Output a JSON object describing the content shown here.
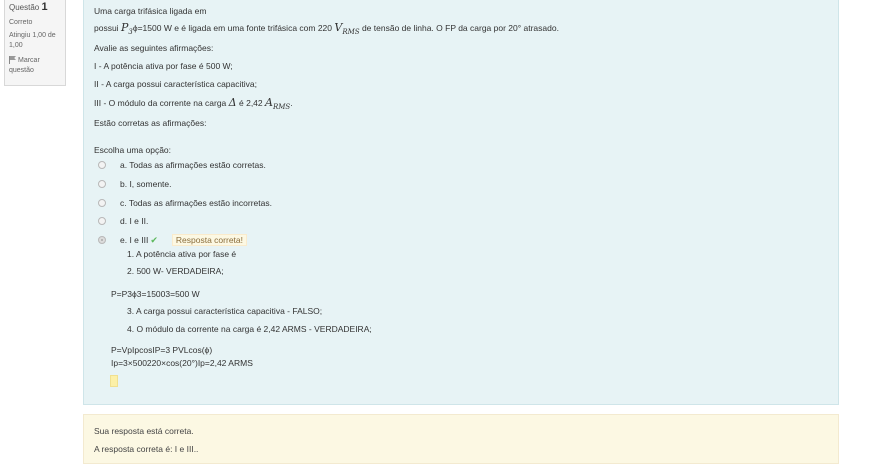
{
  "info": {
    "question_label": "Questão",
    "question_number": "1",
    "state": "Correto",
    "grade": "Atingiu 1,00 de 1,00",
    "flag_label": "Marcar questão"
  },
  "question": {
    "line1": "Uma carga trifásica ligada em",
    "line2_pre": "possui",
    "p_symbol": "P",
    "p_sub": "3",
    "line2_mid": "ϕ=1500 W e é ligada em uma fonte trifásica com 220",
    "v_symbol": "V",
    "v_sub": "RMS",
    "line2_post": "de tensão de linha. O FP da carga por 20° atrasado.",
    "line3": "Avalie as seguintes afirmações:",
    "line4": "I - A potência ativa por fase é 500 W;",
    "line5": "II - A carga possui característica capacitiva;",
    "line6_pre": "III - O módulo da corrente na carga",
    "delta_symbol": "Δ",
    "line6_mid": "é 2,42",
    "a_symbol": "A",
    "a_sub": "RMS",
    "line6_post": ".",
    "line7": "Estão corretas as afirmações:",
    "prompt": "Escolha uma opção:"
  },
  "options": [
    {
      "label": "a. Todas as afirmações estão corretas."
    },
    {
      "label": "b. I, somente."
    },
    {
      "label": "c. Todas as afirmações estão incorretas."
    },
    {
      "label": "d. I e II."
    },
    {
      "label": "e. I e III"
    }
  ],
  "feedback": "Resposta correta!",
  "explanation": {
    "item1": "1. A potência ativa por fase é",
    "item2": "2. 500 W- VERDADEIRA;",
    "formula1": "P=P3ϕ3=15003=500 W",
    "item3": "3. A carga possui característica capacitiva - FALSO;",
    "item4": "4. O módulo da corrente na carga é 2,42 ARMS - VERDADEIRA;",
    "formula2": "P=VpIpcosIP=3 PVLcos(ϕ)",
    "formula3": "Ip=3×500220×cos(20°)Ip=2,42 ARMS"
  },
  "outcome": {
    "line1": "Sua resposta está correta.",
    "line2": "A resposta correta é: I e III.."
  },
  "colors": {
    "formulation_bg": "#e7f3f5",
    "outcome_bg": "#fcf8e3",
    "check_green": "#5cb85c"
  }
}
